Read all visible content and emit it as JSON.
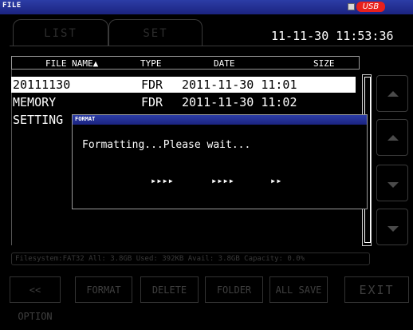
{
  "title": "FILE",
  "usb_badge": "USB",
  "tabs": [
    {
      "label": "LIST"
    },
    {
      "label": "SET"
    }
  ],
  "clock": "11-11-30  11:53:36",
  "table": {
    "headers": {
      "name": "FILE NAME▲",
      "type": "TYPE",
      "date": "DATE",
      "size": "SIZE"
    },
    "rows": [
      {
        "name": "20111130",
        "type": "FDR",
        "date": "2011-11-30 11:01"
      },
      {
        "name": "MEMORY",
        "type": "FDR",
        "date": "2011-11-30 11:02"
      },
      {
        "name": "SETTING",
        "type": "",
        "date": ""
      }
    ]
  },
  "status_line": "Filesystem:FAT32  All: 3.8GB  Used: 392KB  Avail: 3.8GB  Capacity: 0.0%",
  "buttons": [
    {
      "label": "<< OPTION"
    },
    {
      "label": "FORMAT"
    },
    {
      "label": "DELETE"
    },
    {
      "label": "FOLDER"
    },
    {
      "label": "ALL SAVE"
    },
    {
      "label": "EXIT"
    }
  ],
  "dialog": {
    "title": "FORMAT",
    "message": "Formatting...Please wait...",
    "progress": [
      "▸▸▸▸",
      "▸▸▸▸",
      "▸▸"
    ]
  },
  "colors": {
    "title_bar": "#1f2b8f",
    "usb_badge": "#e8201c",
    "selected_row": "#ffffff",
    "inactive": "#3a3a3a"
  },
  "icons": [
    "scroll-up-icon",
    "scroll-up-icon",
    "scroll-down-icon",
    "scroll-down-icon"
  ]
}
